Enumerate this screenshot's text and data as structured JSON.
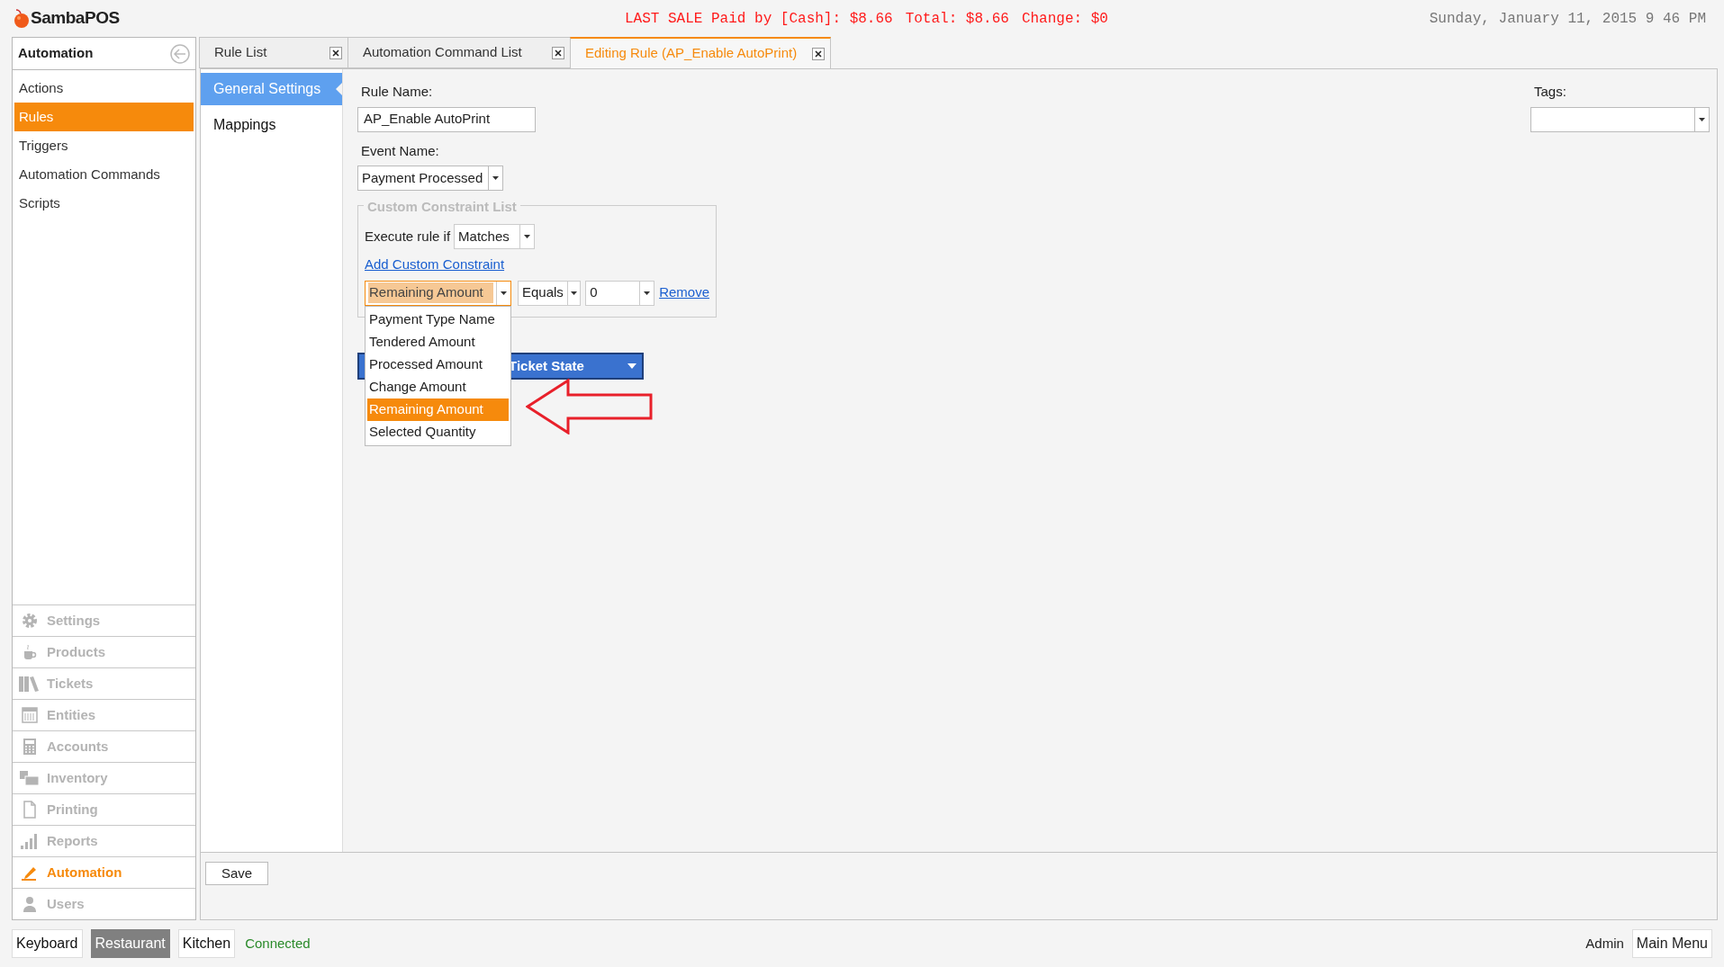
{
  "header": {
    "logo": "SambaPOS",
    "last_sale": [
      "LAST SALE Paid by [Cash]: $8.66",
      "Total: $8.66",
      "Change: $0"
    ],
    "datetime": "Sunday, January 11, 2015 9 46 PM"
  },
  "sidebar": {
    "title": "Automation",
    "items": [
      {
        "label": "Actions",
        "selected": false
      },
      {
        "label": "Rules",
        "selected": true
      },
      {
        "label": "Triggers",
        "selected": false
      },
      {
        "label": "Automation Commands",
        "selected": false
      },
      {
        "label": "Scripts",
        "selected": false
      }
    ],
    "modules": [
      {
        "label": "Settings",
        "selected": false
      },
      {
        "label": "Products",
        "selected": false
      },
      {
        "label": "Tickets",
        "selected": false
      },
      {
        "label": "Entities",
        "selected": false
      },
      {
        "label": "Accounts",
        "selected": false
      },
      {
        "label": "Inventory",
        "selected": false
      },
      {
        "label": "Printing",
        "selected": false
      },
      {
        "label": "Reports",
        "selected": false
      },
      {
        "label": "Automation",
        "selected": true
      },
      {
        "label": "Users",
        "selected": false
      }
    ]
  },
  "tabs": [
    {
      "label": "Rule List",
      "selected": false
    },
    {
      "label": "Automation Command List",
      "selected": false
    },
    {
      "label": "Editing Rule (AP_Enable AutoPrint)",
      "selected": true
    }
  ],
  "sections": [
    {
      "label": "General Settings",
      "selected": true
    },
    {
      "label": "Mappings",
      "selected": false
    }
  ],
  "form": {
    "rule_name_label": "Rule Name:",
    "rule_name": "AP_Enable AutoPrint",
    "event_name_label": "Event Name:",
    "event_name": "Payment Processed",
    "tags_label": "Tags:",
    "constraints": {
      "legend": "Custom Constraint List",
      "execute_label": "Execute rule if",
      "execute_value": "Matches",
      "add_link": "Add Custom Constraint",
      "row": {
        "field": "Remaining Amount",
        "operator": "Equals",
        "value": "0",
        "remove": "Remove"
      },
      "field_options": [
        {
          "label": "Payment Type Name",
          "selected": false
        },
        {
          "label": "Tendered Amount",
          "selected": false
        },
        {
          "label": "Processed Amount",
          "selected": false
        },
        {
          "label": "Change Amount",
          "selected": false
        },
        {
          "label": "Remaining Amount",
          "selected": true
        },
        {
          "label": "Selected Quantity",
          "selected": false
        }
      ]
    },
    "actions_bar": "Ticket State"
  },
  "save": "Save",
  "status_bar": {
    "buttons": [
      {
        "label": "Keyboard",
        "selected": false
      },
      {
        "label": "Restaurant",
        "selected": true
      },
      {
        "label": "Kitchen",
        "selected": false
      }
    ],
    "connection": "Connected",
    "user": "Admin",
    "menu": "Main Menu"
  }
}
